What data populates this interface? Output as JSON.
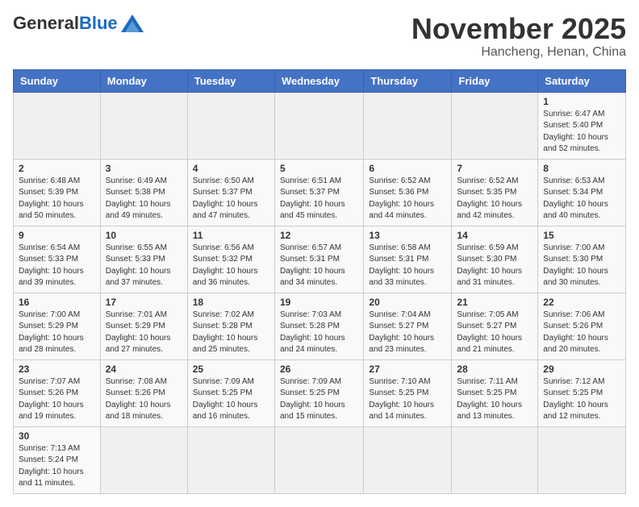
{
  "header": {
    "logo_general": "General",
    "logo_blue": "Blue",
    "month_title": "November 2025",
    "location": "Hancheng, Henan, China"
  },
  "weekdays": [
    "Sunday",
    "Monday",
    "Tuesday",
    "Wednesday",
    "Thursday",
    "Friday",
    "Saturday"
  ],
  "weeks": [
    [
      {
        "day": "",
        "info": ""
      },
      {
        "day": "",
        "info": ""
      },
      {
        "day": "",
        "info": ""
      },
      {
        "day": "",
        "info": ""
      },
      {
        "day": "",
        "info": ""
      },
      {
        "day": "",
        "info": ""
      },
      {
        "day": "1",
        "info": "Sunrise: 6:47 AM\nSunset: 5:40 PM\nDaylight: 10 hours\nand 52 minutes."
      }
    ],
    [
      {
        "day": "2",
        "info": "Sunrise: 6:48 AM\nSunset: 5:39 PM\nDaylight: 10 hours\nand 50 minutes."
      },
      {
        "day": "3",
        "info": "Sunrise: 6:49 AM\nSunset: 5:38 PM\nDaylight: 10 hours\nand 49 minutes."
      },
      {
        "day": "4",
        "info": "Sunrise: 6:50 AM\nSunset: 5:37 PM\nDaylight: 10 hours\nand 47 minutes."
      },
      {
        "day": "5",
        "info": "Sunrise: 6:51 AM\nSunset: 5:37 PM\nDaylight: 10 hours\nand 45 minutes."
      },
      {
        "day": "6",
        "info": "Sunrise: 6:52 AM\nSunset: 5:36 PM\nDaylight: 10 hours\nand 44 minutes."
      },
      {
        "day": "7",
        "info": "Sunrise: 6:52 AM\nSunset: 5:35 PM\nDaylight: 10 hours\nand 42 minutes."
      },
      {
        "day": "8",
        "info": "Sunrise: 6:53 AM\nSunset: 5:34 PM\nDaylight: 10 hours\nand 40 minutes."
      }
    ],
    [
      {
        "day": "9",
        "info": "Sunrise: 6:54 AM\nSunset: 5:33 PM\nDaylight: 10 hours\nand 39 minutes."
      },
      {
        "day": "10",
        "info": "Sunrise: 6:55 AM\nSunset: 5:33 PM\nDaylight: 10 hours\nand 37 minutes."
      },
      {
        "day": "11",
        "info": "Sunrise: 6:56 AM\nSunset: 5:32 PM\nDaylight: 10 hours\nand 36 minutes."
      },
      {
        "day": "12",
        "info": "Sunrise: 6:57 AM\nSunset: 5:31 PM\nDaylight: 10 hours\nand 34 minutes."
      },
      {
        "day": "13",
        "info": "Sunrise: 6:58 AM\nSunset: 5:31 PM\nDaylight: 10 hours\nand 33 minutes."
      },
      {
        "day": "14",
        "info": "Sunrise: 6:59 AM\nSunset: 5:30 PM\nDaylight: 10 hours\nand 31 minutes."
      },
      {
        "day": "15",
        "info": "Sunrise: 7:00 AM\nSunset: 5:30 PM\nDaylight: 10 hours\nand 30 minutes."
      }
    ],
    [
      {
        "day": "16",
        "info": "Sunrise: 7:00 AM\nSunset: 5:29 PM\nDaylight: 10 hours\nand 28 minutes."
      },
      {
        "day": "17",
        "info": "Sunrise: 7:01 AM\nSunset: 5:29 PM\nDaylight: 10 hours\nand 27 minutes."
      },
      {
        "day": "18",
        "info": "Sunrise: 7:02 AM\nSunset: 5:28 PM\nDaylight: 10 hours\nand 25 minutes."
      },
      {
        "day": "19",
        "info": "Sunrise: 7:03 AM\nSunset: 5:28 PM\nDaylight: 10 hours\nand 24 minutes."
      },
      {
        "day": "20",
        "info": "Sunrise: 7:04 AM\nSunset: 5:27 PM\nDaylight: 10 hours\nand 23 minutes."
      },
      {
        "day": "21",
        "info": "Sunrise: 7:05 AM\nSunset: 5:27 PM\nDaylight: 10 hours\nand 21 minutes."
      },
      {
        "day": "22",
        "info": "Sunrise: 7:06 AM\nSunset: 5:26 PM\nDaylight: 10 hours\nand 20 minutes."
      }
    ],
    [
      {
        "day": "23",
        "info": "Sunrise: 7:07 AM\nSunset: 5:26 PM\nDaylight: 10 hours\nand 19 minutes."
      },
      {
        "day": "24",
        "info": "Sunrise: 7:08 AM\nSunset: 5:26 PM\nDaylight: 10 hours\nand 18 minutes."
      },
      {
        "day": "25",
        "info": "Sunrise: 7:09 AM\nSunset: 5:25 PM\nDaylight: 10 hours\nand 16 minutes."
      },
      {
        "day": "26",
        "info": "Sunrise: 7:09 AM\nSunset: 5:25 PM\nDaylight: 10 hours\nand 15 minutes."
      },
      {
        "day": "27",
        "info": "Sunrise: 7:10 AM\nSunset: 5:25 PM\nDaylight: 10 hours\nand 14 minutes."
      },
      {
        "day": "28",
        "info": "Sunrise: 7:11 AM\nSunset: 5:25 PM\nDaylight: 10 hours\nand 13 minutes."
      },
      {
        "day": "29",
        "info": "Sunrise: 7:12 AM\nSunset: 5:25 PM\nDaylight: 10 hours\nand 12 minutes."
      }
    ],
    [
      {
        "day": "30",
        "info": "Sunrise: 7:13 AM\nSunset: 5:24 PM\nDaylight: 10 hours\nand 11 minutes."
      },
      {
        "day": "",
        "info": ""
      },
      {
        "day": "",
        "info": ""
      },
      {
        "day": "",
        "info": ""
      },
      {
        "day": "",
        "info": ""
      },
      {
        "day": "",
        "info": ""
      },
      {
        "day": "",
        "info": ""
      }
    ]
  ]
}
